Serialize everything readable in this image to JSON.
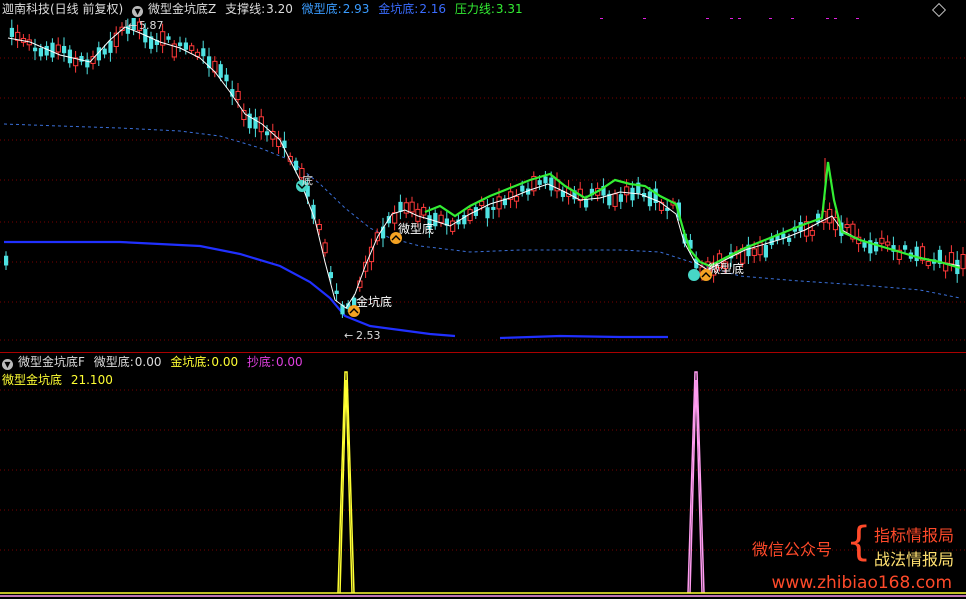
{
  "main_header": {
    "stock": "迦南科技(日线 前复权)",
    "indicator_name": "微型金坑底Z",
    "support_label": "支撑线:",
    "support_value": "3.20",
    "micro_label": "微型底:",
    "micro_value": "2.93",
    "gold_label": "金坑底:",
    "gold_value": "2.16",
    "pressure_label": "压力线:",
    "pressure_value": "3.31"
  },
  "price_annotations": {
    "high_value": "5.87",
    "low_value": "2.53",
    "signal_gold": "金坑底",
    "signal_micro_1": "微型底",
    "signal_micro_2": "微型底",
    "signal_di": "底"
  },
  "sub_header": {
    "indicator_name": "微型金坑底F",
    "micro_label": "微型底:",
    "micro_value": "0.00",
    "gold_label": "金坑底:",
    "gold_value": "0.00",
    "chao_label": "抄底:",
    "chao_value": "0.00",
    "sub_title": "微型金坑底",
    "sub_value": "21.100"
  },
  "watermark": {
    "wechat": "微信公众号",
    "line1": "指标情报局",
    "line2": "战法情报局",
    "url": "www.zhibiao168.com"
  },
  "colors": {
    "up": "#ff3a3a",
    "down": "#4fe3e3",
    "ma": "#ffffff",
    "green_line": "#33ee33",
    "blue_line": "#2030ff",
    "dashed": "#3a6fd8",
    "yellow": "#ffff33",
    "pink": "#ff9cf0",
    "grid": "#7a0000"
  },
  "icons": [
    "collapse-icon",
    "diamond-icon",
    "gold-signal-icon",
    "micro-signal-icon"
  ],
  "chart_data": {
    "type": "candlestick",
    "price_high": 5.87,
    "price_low": 2.53,
    "signals": [
      "金坑底",
      "微型底",
      "微型底"
    ],
    "sub_indicator": {
      "type": "spike",
      "series": [
        {
          "name": "金坑底",
          "color": "yellow",
          "peak": 21.1
        },
        {
          "name": "抄底",
          "color": "pink",
          "peak": 21.1
        }
      ]
    }
  }
}
